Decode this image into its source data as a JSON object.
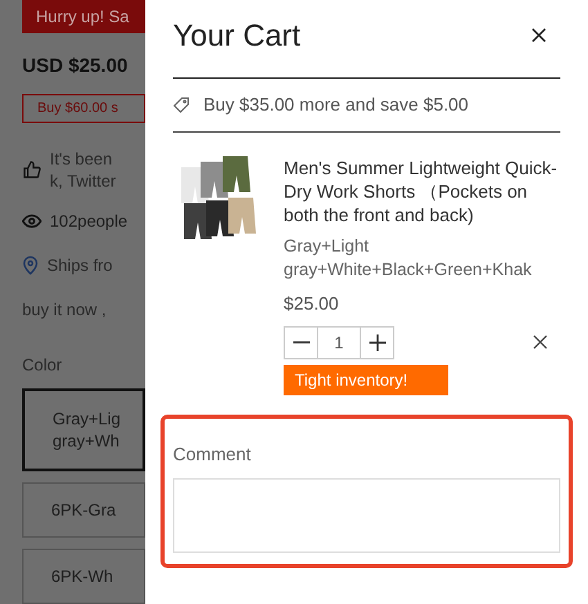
{
  "background_page": {
    "banner": "Hurry up! Sa",
    "price": "USD $25.00",
    "offer": "Buy $60.00 s",
    "social_lines": [
      "It's been",
      "k, Twitter"
    ],
    "viewers": "102people",
    "shipping": "Ships fro",
    "note": "buy it now ,",
    "color_label": "Color",
    "color_options": [
      {
        "label": "Gray+Lig\ngray+Wh",
        "selected": true
      },
      {
        "label": "6PK-Gra",
        "selected": false
      },
      {
        "label": "6PK-Wh",
        "selected": false
      }
    ]
  },
  "cart": {
    "title": "Your Cart",
    "discount": "Buy $35.00 more and save $5.00",
    "items": [
      {
        "name": "Men's Summer Lightweight Quick-Dry Work Shorts  （Pockets on both the front and back)",
        "variant": "Gray+Light gray+White+Black+Green+Khak",
        "price": "$25.00",
        "quantity": "1",
        "badge": "Tight inventory!"
      }
    ],
    "comment": {
      "label": "Comment"
    }
  }
}
